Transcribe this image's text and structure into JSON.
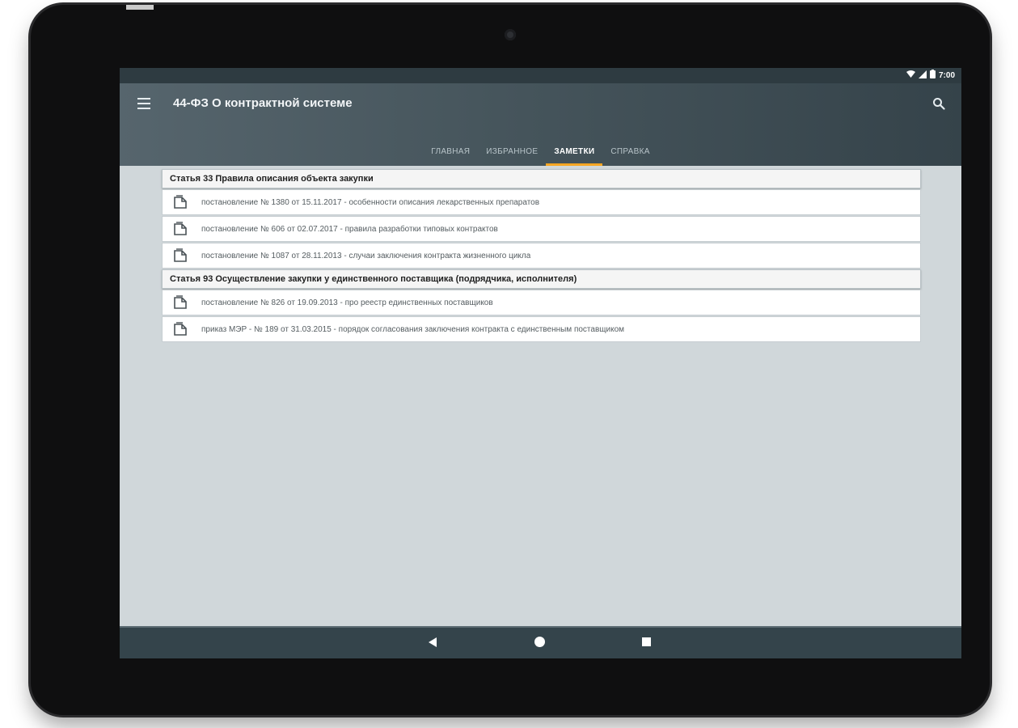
{
  "statusbar": {
    "time": "7:00",
    "icons": [
      "wifi-icon",
      "signal-icon",
      "battery-icon"
    ]
  },
  "appbar": {
    "title": "44-ФЗ О контрактной системе",
    "menu_icon": "menu-icon",
    "search_icon": "search-icon"
  },
  "tabs": [
    {
      "label": "ГЛАВНАЯ",
      "active": false
    },
    {
      "label": "ИЗБРАННОЕ",
      "active": false
    },
    {
      "label": "ЗАМЕТКИ",
      "active": true
    },
    {
      "label": "СПРАВКА",
      "active": false
    }
  ],
  "colors": {
    "accent": "#f5a623",
    "appbar": "#46555c",
    "background": "#d0d7da"
  },
  "sections": [
    {
      "title": "Статья 33  Правила описания объекта закупки",
      "notes": [
        {
          "text": "постановление № 1380 от 15.11.2017 - особенности описания лекарственных препаратов"
        },
        {
          "text": "постановление № 606 от 02.07.2017 - правила разработки типовых контрактов"
        },
        {
          "text": "постановление № 1087 от 28.11.2013 - случаи заключения контракта жизненного цикла"
        }
      ]
    },
    {
      "title": "Статья 93  Осуществление закупки у единственного поставщика (подрядчика, исполнителя)",
      "notes": [
        {
          "text": "постановление № 826 от 19.09.2013 - про реестр единственных поставщиков"
        },
        {
          "text": "приказ МЭР - № 189 от 31.03.2015 - порядок согласования заключения контракта с единственным поставщиком"
        }
      ]
    }
  ],
  "navbar": {
    "icons": [
      "back-icon",
      "home-icon",
      "recents-icon"
    ]
  }
}
